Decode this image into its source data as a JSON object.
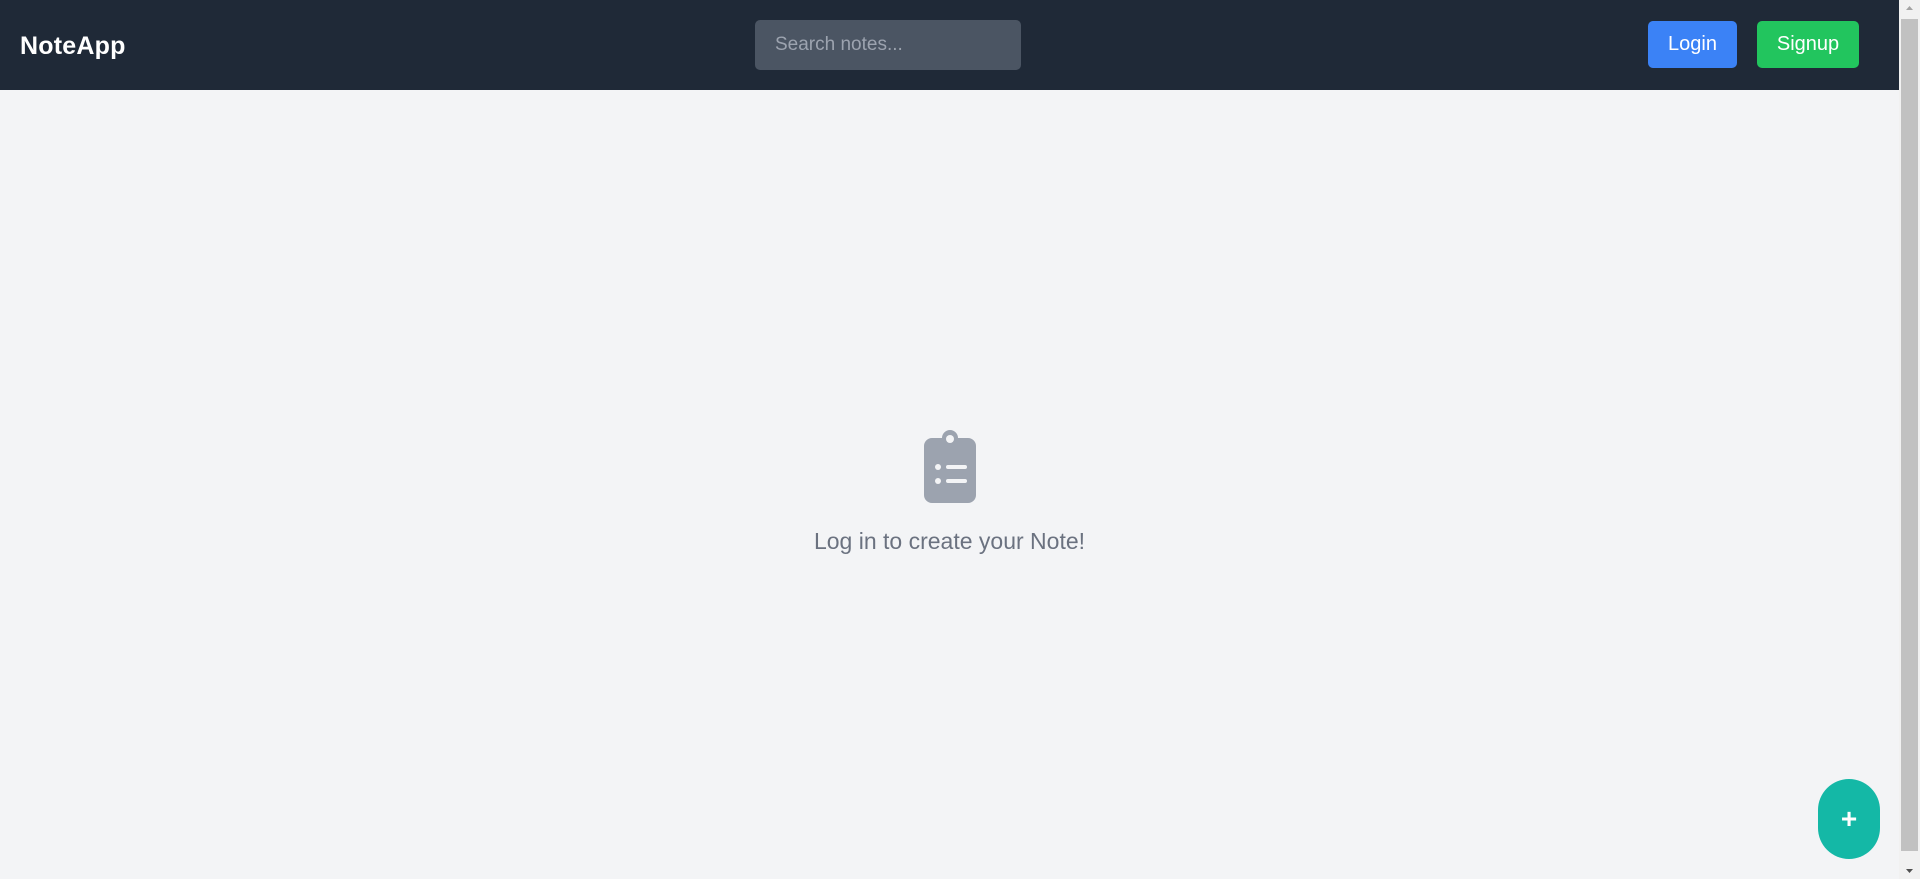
{
  "app": {
    "brand": "NoteApp"
  },
  "header": {
    "search_placeholder": "Search notes...",
    "login_label": "Login",
    "signup_label": "Signup"
  },
  "main": {
    "empty_icon": "clipboard-list-icon",
    "empty_message": "Log in to create your Note!"
  },
  "fab": {
    "label": "+",
    "icon": "plus-icon"
  },
  "colors": {
    "navbar": "#1f2937",
    "background": "#f3f4f6",
    "login": "#3b82f6",
    "signup": "#22c55e",
    "fab": "#14b8a6",
    "muted_text": "#6b7280",
    "icon": "#9ca3af"
  }
}
